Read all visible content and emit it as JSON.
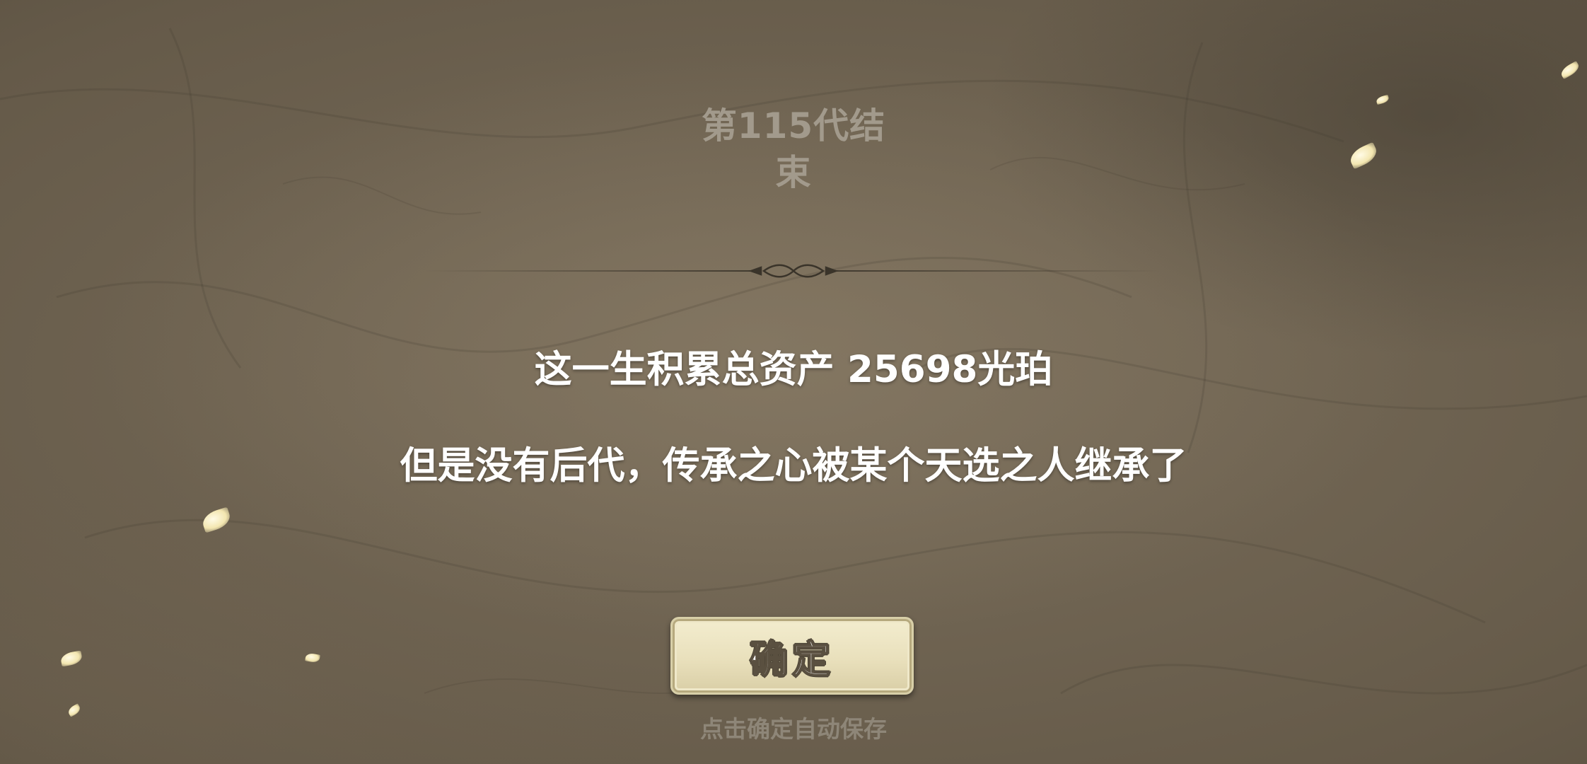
{
  "generation": {
    "title_line1": "第115代结",
    "title_line2": "束"
  },
  "summary": {
    "assets_text": "这一生积累总资产 25698光珀",
    "heir_text": "但是没有后代，传承之心被某个天选之人继承了"
  },
  "confirm": {
    "label": "确定",
    "hint": "点击确定自动保存"
  }
}
